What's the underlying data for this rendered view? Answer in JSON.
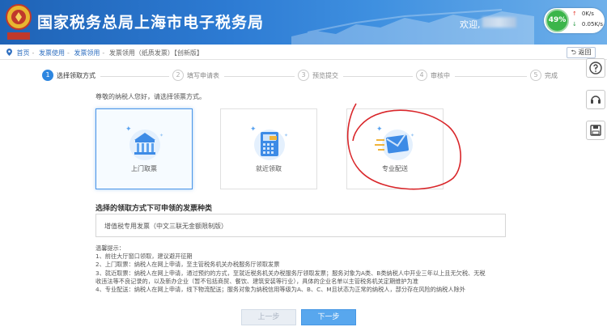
{
  "header": {
    "title": "国家税务总局上海市电子税务局",
    "welcome": "欢迎,",
    "speed": {
      "percent": "49%",
      "up": "0K/s",
      "down": "0.05K/s"
    },
    "colors": {
      "primary": "#1f63b6",
      "accent": "#2d86e0"
    }
  },
  "breadcrumb": {
    "items": [
      "首页",
      "发票使用",
      "发票领用",
      "发票领用（纸质发票）【创新版】"
    ],
    "back_label": "返回"
  },
  "steps": [
    {
      "num": "1",
      "label": "选择领取方式"
    },
    {
      "num": "2",
      "label": "填写申请表"
    },
    {
      "num": "3",
      "label": "预览提交"
    },
    {
      "num": "4",
      "label": "审核中"
    },
    {
      "num": "5",
      "label": "完成"
    }
  ],
  "active_step": 1,
  "greeting": "尊敬的纳税人您好，请选择领票方式。",
  "methods": [
    {
      "label": "上门取票",
      "icon": "bank-building-icon",
      "selected": true
    },
    {
      "label": "就近领取",
      "icon": "invoice-machine-icon",
      "selected": false
    },
    {
      "label": "专业配送",
      "icon": "mail-delivery-icon",
      "selected": false
    }
  ],
  "invoice_section": {
    "title": "选择的领取方式下可申领的发票种类",
    "value": "增值税专用发票（中文三联无金额限制版）"
  },
  "tips": {
    "title": "温馨提示：",
    "lines": [
      "1、前往大厅窗口领取，建议避开征期",
      "2、上门取票：纳税人在网上申请，至主管税务机关办税服务厅领取发票",
      "3、就近取票：纳税人在网上申请，通过预约的方式，至就近税务机关办税服务厅领取发票；服务对象为A类、B类纳税人中开业三年以上且无欠税、无税",
      "收违法等不良记录的，以及新办企业（暂不包括商贸、餐饮、建筑安装等行业），具体的企业名单以主管税务机关定期维护为准",
      "4、专业配送：纳税人在网上申请，线下物流配送；服务对象为纳税信用等级为A、B、C、M且状态为正常的纳税人，部分存在风险的纳税人除外"
    ]
  },
  "buttons": {
    "prev": "上一步",
    "next": "下一步"
  }
}
